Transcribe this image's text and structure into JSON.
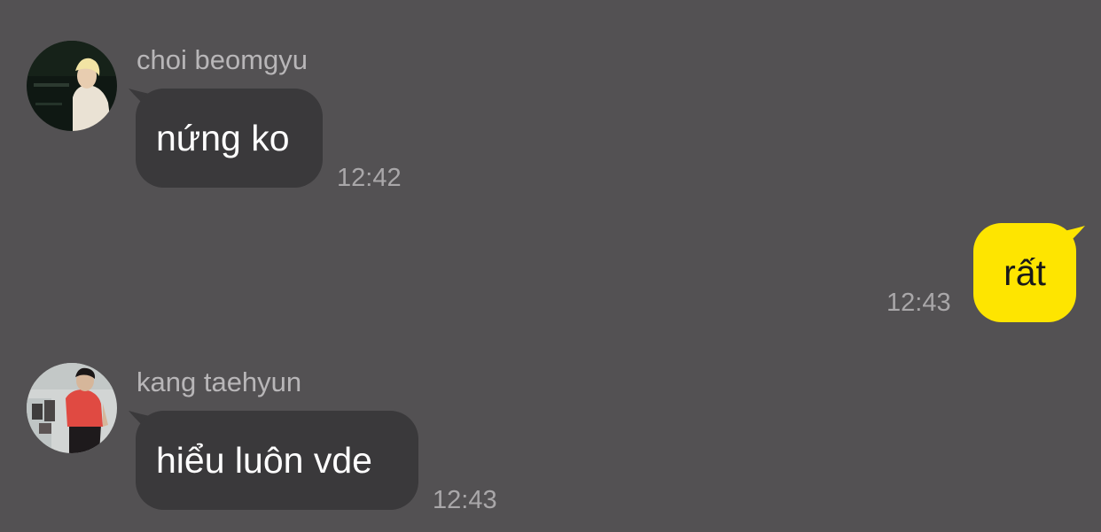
{
  "messages": [
    {
      "direction": "incoming",
      "sender": "choi beomgyu",
      "avatar_icon": "profile-photo-avatar",
      "text": "nứng ko",
      "time": "12:42"
    },
    {
      "direction": "outgoing",
      "text": "rất",
      "time": "12:43"
    },
    {
      "direction": "incoming",
      "sender": "kang taehyun",
      "avatar_icon": "profile-photo-avatar",
      "text": "hiểu luôn vde",
      "time": "12:43"
    }
  ],
  "colors": {
    "background": "#535153",
    "incoming_bubble": "#3a393b",
    "outgoing_bubble": "#fee500",
    "sender_name": "#b8b6b8",
    "timestamp": "#a9a7a9"
  }
}
